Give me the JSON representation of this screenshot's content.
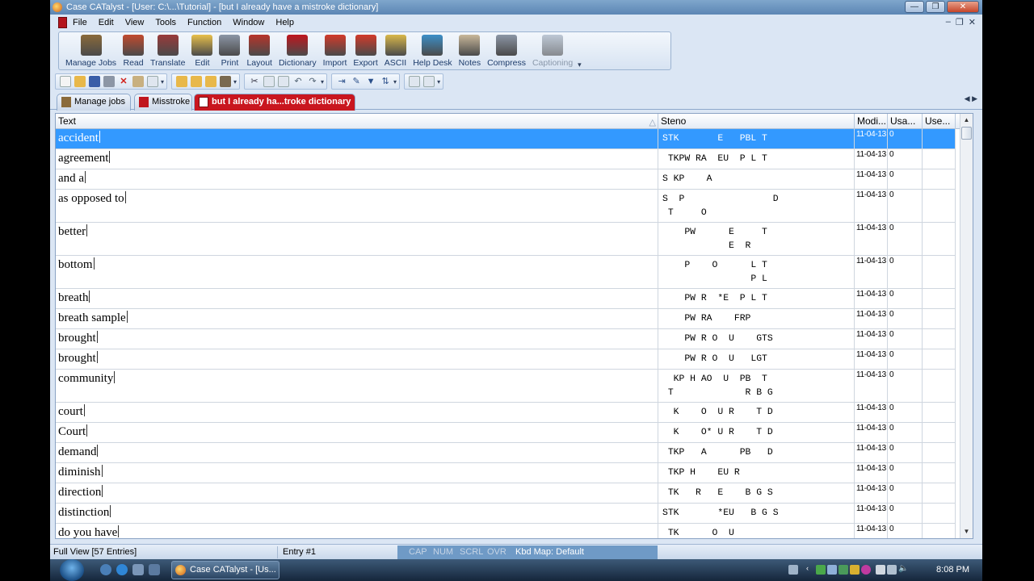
{
  "window": {
    "title": "Case CATalyst - [User: C:\\...\\Tutorial] - [but I already have a mistroke dictionary]",
    "min": "—",
    "max": "❐",
    "close": "✕"
  },
  "menu": {
    "items": [
      "File",
      "Edit",
      "View",
      "Tools",
      "Function",
      "Window",
      "Help"
    ],
    "mdi": [
      "–",
      "❐",
      "✕"
    ]
  },
  "toolbar": {
    "buttons": [
      {
        "label": "Manage Jobs",
        "icon": "manage-jobs-icon",
        "color": "#8a6a3a"
      },
      {
        "label": "Read",
        "icon": "read-icon",
        "color": "#c24a2e"
      },
      {
        "label": "Translate",
        "icon": "translate-icon",
        "color": "#9a3a3a"
      },
      {
        "label": "Edit",
        "icon": "edit-icon",
        "color": "#e8c04a"
      },
      {
        "label": "Print",
        "icon": "print-icon",
        "color": "#8c96a6"
      },
      {
        "label": "Layout",
        "icon": "layout-icon",
        "color": "#b8342a"
      },
      {
        "label": "Dictionary",
        "icon": "dictionary-icon",
        "color": "#c0161e"
      },
      {
        "label": "Import",
        "icon": "import-icon",
        "color": "#d23a2a"
      },
      {
        "label": "Export",
        "icon": "export-icon",
        "color": "#d23a2a"
      },
      {
        "label": "ASCII",
        "icon": "ascii-icon",
        "color": "#d9b84a"
      },
      {
        "label": "Help Desk",
        "icon": "help-desk-icon",
        "color": "#3c8fc8"
      },
      {
        "label": "Notes",
        "icon": "notes-icon",
        "color": "#c9b89a"
      },
      {
        "label": "Compress",
        "icon": "compress-icon",
        "color": "#8c96a6"
      },
      {
        "label": "Captioning",
        "icon": "captioning-icon",
        "color": "#9aa8bb",
        "disabled": true
      }
    ]
  },
  "tabs": [
    {
      "label": "Manage jobs",
      "active": false
    },
    {
      "label": "Misstroke",
      "active": false
    },
    {
      "label": "but I already ha...troke dictionary",
      "active": true
    }
  ],
  "tab_nav": "◀ ▶",
  "grid": {
    "headers": {
      "text": "Text",
      "steno": "Steno",
      "modified": "Modi...",
      "usage": "Usa...",
      "user": "Use..."
    },
    "rows": [
      {
        "text": "accident",
        "steno": [
          "STK       E   PBL T"
        ],
        "mod": "11-04-13",
        "usage": "0",
        "selected": true
      },
      {
        "text": "agreement",
        "steno": [
          " TKPW RA  EU  P L T"
        ],
        "mod": "11-04-13",
        "usage": "0"
      },
      {
        "text": "and a",
        "steno": [
          "S KP    A"
        ],
        "mod": "11-04-13",
        "usage": "0"
      },
      {
        "text": "as opposed to",
        "steno": [
          "S  P                D",
          " T     O"
        ],
        "mod": "11-04-13",
        "usage": "0"
      },
      {
        "text": "better",
        "steno": [
          "    PW      E     T",
          "            E  R"
        ],
        "mod": "11-04-13",
        "usage": "0"
      },
      {
        "text": "bottom",
        "steno": [
          "    P    O      L T",
          "                P L"
        ],
        "mod": "11-04-13",
        "usage": "0"
      },
      {
        "text": "breath",
        "steno": [
          "    PW R  *E  P L T"
        ],
        "mod": "11-04-13",
        "usage": "0"
      },
      {
        "text": "breath sample",
        "steno": [
          "    PW RA    FRP"
        ],
        "mod": "11-04-13",
        "usage": "0"
      },
      {
        "text": "brought",
        "steno": [
          "    PW R O  U    GTS"
        ],
        "mod": "11-04-13",
        "usage": "0"
      },
      {
        "text": "brought",
        "steno": [
          "    PW R O  U   LGT"
        ],
        "mod": "11-04-13",
        "usage": "0"
      },
      {
        "text": "community",
        "steno": [
          "  KP H AO  U  PB  T",
          " T             R B G"
        ],
        "mod": "11-04-13",
        "usage": "0"
      },
      {
        "text": "court",
        "steno": [
          "  K    O  U R    T D"
        ],
        "mod": "11-04-13",
        "usage": "0"
      },
      {
        "text": "Court",
        "steno": [
          "  K    O* U R    T D"
        ],
        "mod": "11-04-13",
        "usage": "0"
      },
      {
        "text": "demand",
        "steno": [
          " TKP   A      PB   D"
        ],
        "mod": "11-04-13",
        "usage": "0"
      },
      {
        "text": "diminish",
        "steno": [
          " TKP H    EU R"
        ],
        "mod": "11-04-13",
        "usage": "0"
      },
      {
        "text": "direction",
        "steno": [
          " TK   R   E    B G S"
        ],
        "mod": "11-04-13",
        "usage": "0"
      },
      {
        "text": "distinction",
        "steno": [
          "STK       *EU   B G S"
        ],
        "mod": "11-04-13",
        "usage": "0"
      },
      {
        "text": "do you have",
        "steno": [
          " TK      O  U"
        ],
        "mod": "11-04-13",
        "usage": "0"
      }
    ]
  },
  "status": {
    "view": "Full View [57 Entries]",
    "entry": "Entry #1",
    "cap": "CAP",
    "num": "NUM",
    "scrl": "SCRL",
    "ovr": "OVR",
    "kbd": "Kbd Map: Default"
  },
  "taskbar": {
    "task_label": "Case CATalyst - [Us...",
    "clock": "8:08 PM"
  }
}
